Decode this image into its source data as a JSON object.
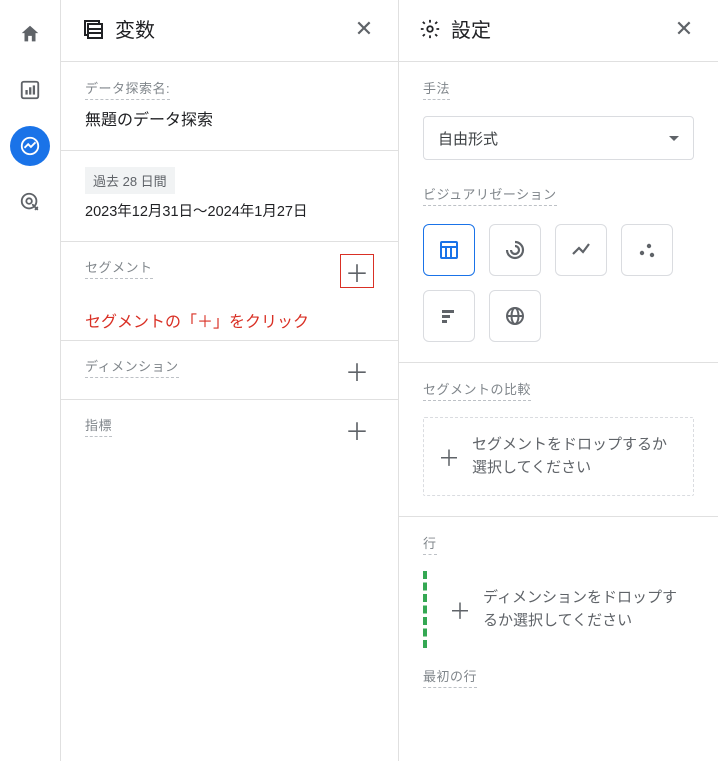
{
  "rail": {
    "items": [
      {
        "name": "home-icon"
      },
      {
        "name": "bar-chart-icon"
      },
      {
        "name": "explore-icon"
      },
      {
        "name": "target-icon"
      }
    ]
  },
  "variables": {
    "title": "変数",
    "exploration_name_label": "データ探索名:",
    "exploration_name_value": "無題のデータ探索",
    "date_chip": "過去 28 日間",
    "date_range": "2023年12月31日～2024年1月27日",
    "segments_label": "セグメント",
    "segments_annotation": "セグメントの「＋」をクリック",
    "dimensions_label": "ディメンション",
    "metrics_label": "指標"
  },
  "settings": {
    "title": "設定",
    "technique_label": "手法",
    "technique_value": "自由形式",
    "visualization_label": "ビジュアリゼーション",
    "segment_compare_label": "セグメントの比較",
    "segment_drop_text": "セグメントをドロップするか選択してください",
    "rows_label": "行",
    "rows_drop_text": "ディメンションをドロップするか選択してください",
    "first_row_label": "最初の行"
  }
}
